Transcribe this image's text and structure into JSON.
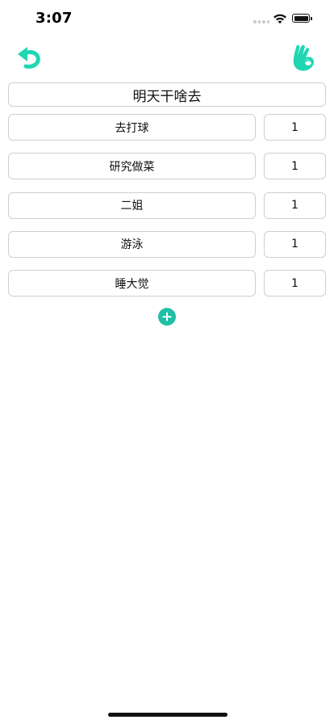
{
  "status_bar": {
    "time": "3:07"
  },
  "toolbar": {
    "undo_icon": "undo-icon",
    "confirm_icon": "ok-hand-icon",
    "accent_color": "#1fd6b3"
  },
  "title": "明天干啥去",
  "items": [
    {
      "name": "去打球",
      "weight": "1"
    },
    {
      "name": "研究做菜",
      "weight": "1"
    },
    {
      "name": "二姐",
      "weight": "1"
    },
    {
      "name": "游泳",
      "weight": "1"
    },
    {
      "name": "睡大觉",
      "weight": "1"
    }
  ],
  "add_button": {
    "icon": "plus-icon",
    "color": "#1fc0a6"
  }
}
